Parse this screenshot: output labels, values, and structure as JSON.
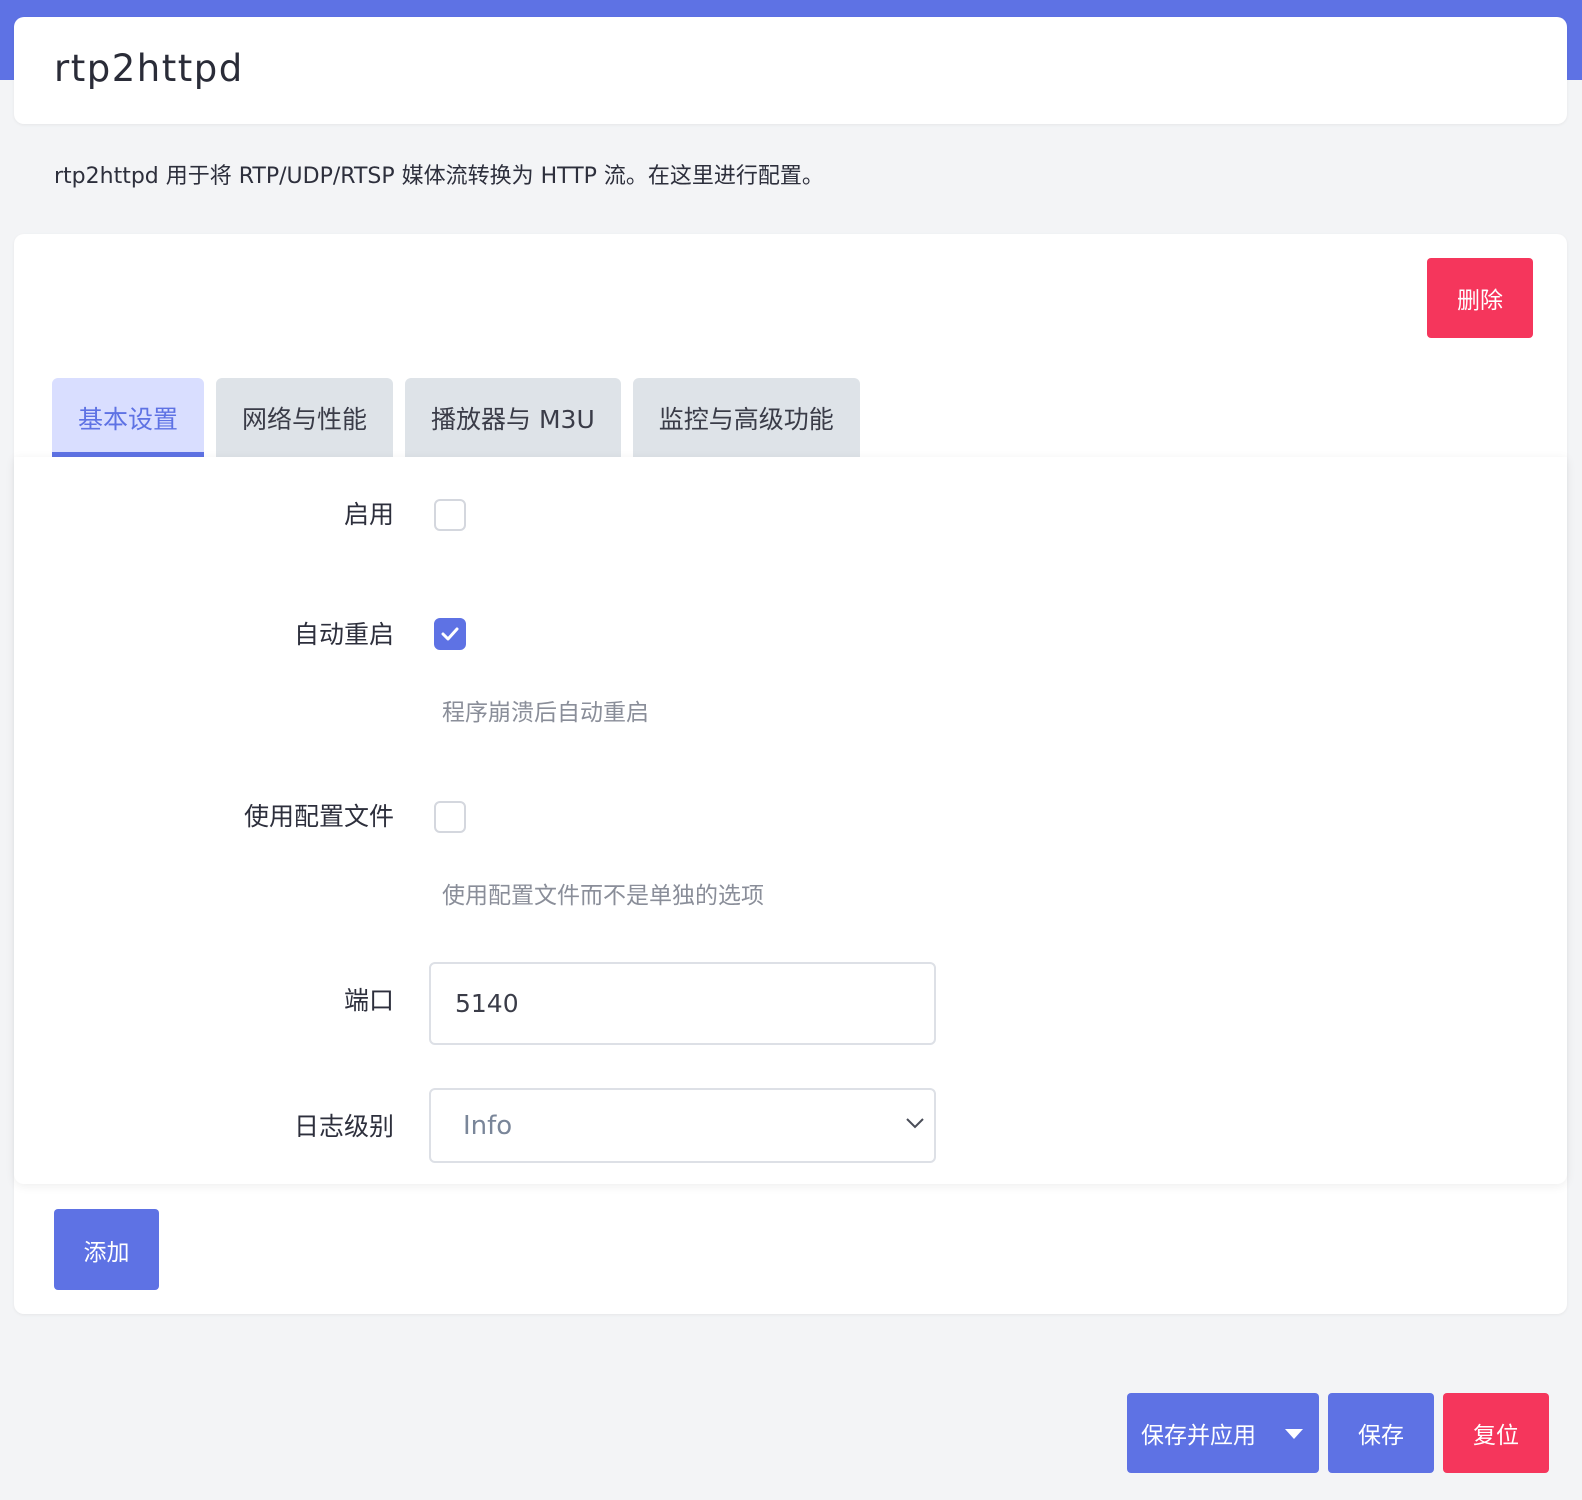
{
  "colors": {
    "accent": "#5e72e4",
    "danger": "#f5365c",
    "tab_inactive": "#dee3e8",
    "tab_active_bg": "#d9deff",
    "page_bg": "#f3f4f6"
  },
  "header": {
    "title": "rtp2httpd"
  },
  "description": "rtp2httpd 用于将 RTP/UDP/RTSP 媒体流转换为 HTTP 流。在这里进行配置。",
  "section": {
    "delete_label": "删除",
    "add_label": "添加",
    "tabs": [
      {
        "label": "基本设置",
        "active": true
      },
      {
        "label": "网络与性能",
        "active": false
      },
      {
        "label": "播放器与 M3U",
        "active": false
      },
      {
        "label": "监控与高级功能",
        "active": false
      }
    ],
    "fields": {
      "enable": {
        "label": "启用",
        "checked": false
      },
      "auto_restart": {
        "label": "自动重启",
        "checked": true,
        "hint": "程序崩溃后自动重启"
      },
      "use_config_file": {
        "label": "使用配置文件",
        "checked": false,
        "hint": "使用配置文件而不是单独的选项"
      },
      "port": {
        "label": "端口",
        "value": "5140"
      },
      "log_level": {
        "label": "日志级别",
        "value": "Info",
        "icon": "chevron-down-icon"
      }
    }
  },
  "footer": {
    "save_apply_label": "保存并应用",
    "save_apply_icon": "caret-down-icon",
    "save_label": "保存",
    "reset_label": "复位"
  }
}
